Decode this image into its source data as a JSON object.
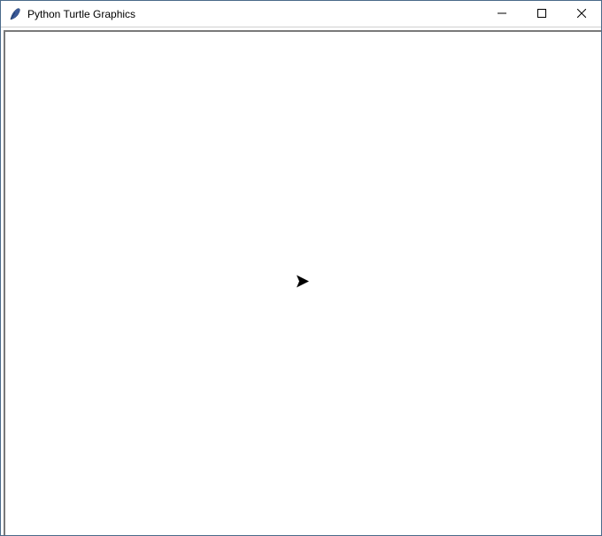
{
  "window": {
    "title": "Python Turtle Graphics",
    "icon_alt": "feather-icon"
  },
  "controls": {
    "minimize_label": "Minimize",
    "maximize_label": "Maximize",
    "close_label": "Close"
  },
  "canvas": {
    "cursor_shape": "classic",
    "cursor_heading": 0
  }
}
